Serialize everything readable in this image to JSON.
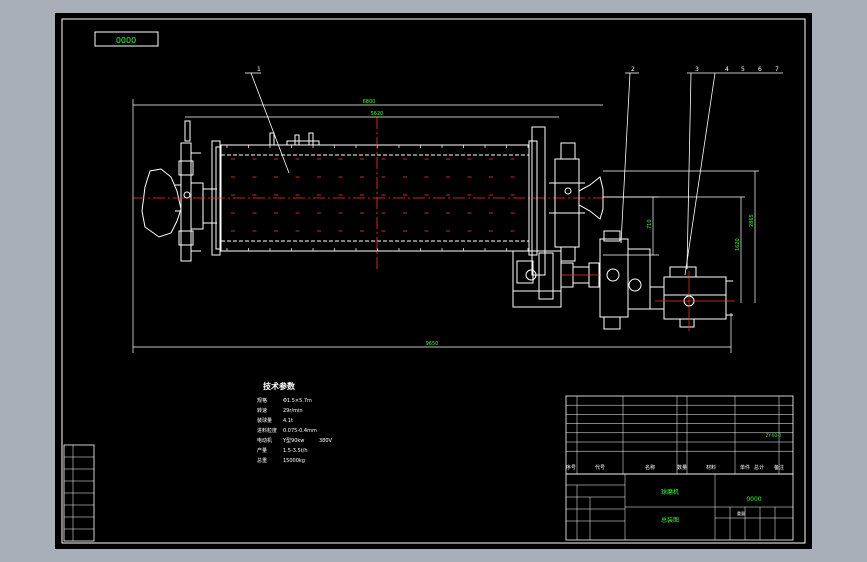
{
  "title_block": {
    "code_tag": "0000",
    "headers": [
      "序号",
      "代号",
      "名称",
      "数量",
      "材料",
      "单件",
      "总计",
      "备注"
    ],
    "weight_label": "重量",
    "drawing_name": "球磨机",
    "drawing_title": "总装图",
    "drawing_no": "0000",
    "side_code": "ZY-00-0"
  },
  "tech": {
    "heading": "技术参数",
    "rows": [
      {
        "label": "规格",
        "value": "Φ1.5×5.7m"
      },
      {
        "label": "转速",
        "value": "29r/min"
      },
      {
        "label": "装球量",
        "value": "4.1t"
      },
      {
        "label": "进料粒度",
        "value": "0.075-0.4mm"
      },
      {
        "label": "电动机",
        "value": "Y型90kw",
        "note": "380V"
      },
      {
        "label": "产量",
        "value": "1.5-3.5t/h"
      },
      {
        "label": "总重",
        "value": "15000kg"
      }
    ]
  },
  "balloons": [
    "1",
    "2",
    "3",
    "4",
    "5",
    "6",
    "7"
  ],
  "dims": {
    "overall_top": "6800",
    "barrel": "5620",
    "overall_bottom": "9650",
    "v1": "1620",
    "v2": "2865",
    "v3": "710"
  },
  "colors": {
    "line": "#ffffff",
    "body": "#ff3030",
    "accent": "#33ff33",
    "bg": "#000000"
  }
}
